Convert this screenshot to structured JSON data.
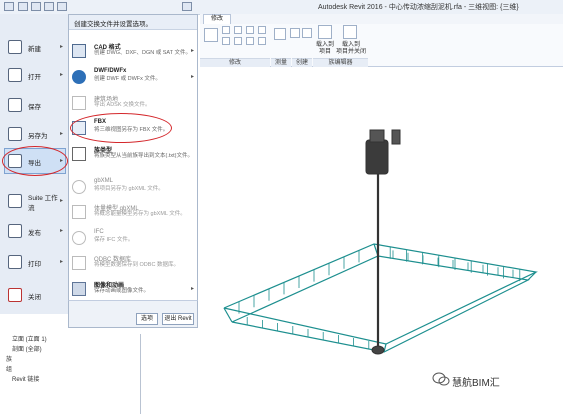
{
  "window": {
    "title": "Autodesk Revit 2016 -   中心传动浓缩刮泥机.rfa - 三维视图: {三维}"
  },
  "ribbon": {
    "tabs": [
      "修改"
    ],
    "panels": [
      "修改",
      "测量",
      "创建",
      "族编辑器"
    ],
    "buttons": [
      {
        "label": "载入到\n项目"
      },
      {
        "label": "载入到\n项目并关闭"
      }
    ]
  },
  "app_menu": {
    "header": "创建交换文件并设置选项。",
    "items": [
      {
        "label": "新建",
        "has_submenu": true,
        "icon": "new-icon"
      },
      {
        "label": "打开",
        "has_submenu": true,
        "icon": "open-icon"
      },
      {
        "label": "保存",
        "has_submenu": false,
        "icon": "save-icon"
      },
      {
        "label": "另存为",
        "has_submenu": true,
        "icon": "save-as-icon"
      },
      {
        "label": "导出",
        "has_submenu": true,
        "icon": "export-icon",
        "selected": true
      },
      {
        "label": "Suite 工作流",
        "has_submenu": true,
        "icon": "suite-icon"
      },
      {
        "label": "发布",
        "has_submenu": true,
        "icon": "publish-icon"
      },
      {
        "label": "打印",
        "has_submenu": true,
        "icon": "print-icon"
      },
      {
        "label": "关闭",
        "has_submenu": false,
        "icon": "close-icon"
      }
    ],
    "export_items": [
      {
        "title": "CAD 格式",
        "desc": "创建 DWG、DXF、DGN 或 SAT 文件。",
        "enabled": true,
        "submenu": true,
        "icon": "cad-icon"
      },
      {
        "title": "DWF/DWFx",
        "desc": "创建 DWF 或 DWFx 文件。",
        "enabled": true,
        "submenu": true,
        "icon": "dwf-icon"
      },
      {
        "title": "建筑场地",
        "desc": "导出 ADSK 交换文件。",
        "enabled": false,
        "submenu": false,
        "icon": "site-icon"
      },
      {
        "title": "FBX",
        "desc": "将三维视图另存为 FBX 文件。",
        "enabled": true,
        "submenu": false,
        "icon": "fbx-icon",
        "highlighted": true
      },
      {
        "title": "族类型",
        "desc": "将族类型从当前族导出到文本(.txt)文件。",
        "enabled": true,
        "submenu": false,
        "icon": "family-types-icon"
      },
      {
        "title": "gbXML",
        "desc": "将项目另存为 gbXML 文件。",
        "enabled": false,
        "submenu": false,
        "icon": "gbxml-icon"
      },
      {
        "title": "体量模型 gbXML",
        "desc": "将概念能量模型另存为 gbXML 文件。",
        "enabled": false,
        "submenu": false,
        "icon": "mass-gbxml-icon"
      },
      {
        "title": "IFC",
        "desc": "保存 IFC 文件。",
        "enabled": false,
        "submenu": false,
        "icon": "ifc-icon"
      },
      {
        "title": "ODBC 数据库",
        "desc": "将模型数据保存到 ODBC 数据库。",
        "enabled": false,
        "submenu": false,
        "icon": "odbc-icon"
      },
      {
        "title": "图像和动画",
        "desc": "保存动画或图像文件。",
        "enabled": true,
        "submenu": true,
        "icon": "image-icon"
      }
    ],
    "footer_buttons": [
      "选项",
      "退出 Revit"
    ]
  },
  "project_browser": {
    "items": [
      "立面 (立面 1)",
      "剖面 (全部)",
      "族",
      "组",
      "Revit 链接"
    ]
  },
  "watermark": {
    "text": "慧航BIM汇"
  },
  "colors": {
    "accent": "#d4282c",
    "model": "#1d8f8f",
    "selection": "#cfe0f5"
  }
}
